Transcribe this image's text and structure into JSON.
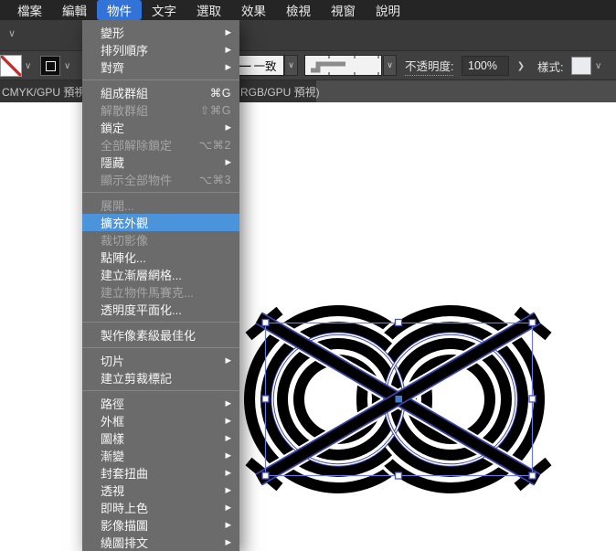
{
  "menubar": {
    "items": [
      {
        "label": "檔案",
        "active": false
      },
      {
        "label": "編輯",
        "active": false
      },
      {
        "label": "物件",
        "active": true
      },
      {
        "label": "文字",
        "active": false
      },
      {
        "label": "選取",
        "active": false
      },
      {
        "label": "效果",
        "active": false
      },
      {
        "label": "檢視",
        "active": false
      },
      {
        "label": "視窗",
        "active": false
      },
      {
        "label": "說明",
        "active": false
      }
    ],
    "highlight_color": "#3273d8"
  },
  "object_menu": {
    "highlight_color": "#4b94db",
    "items": [
      {
        "label": "變形",
        "arrow": true
      },
      {
        "label": "排列順序",
        "arrow": true
      },
      {
        "label": "對齊",
        "arrow": true,
        "sep": true
      },
      {
        "label": "組成群組",
        "shortcut": "⌘G"
      },
      {
        "label": "解散群組",
        "shortcut": "⇧⌘G",
        "disabled": true
      },
      {
        "label": "鎖定",
        "arrow": true
      },
      {
        "label": "全部解除鎖定",
        "shortcut": "⌥⌘2",
        "disabled": true
      },
      {
        "label": "隱藏",
        "arrow": true
      },
      {
        "label": "顯示全部物件",
        "shortcut": "⌥⌘3",
        "disabled": true,
        "sep": true
      },
      {
        "label": "展開...",
        "disabled": true
      },
      {
        "label": "擴充外觀",
        "highlighted": true
      },
      {
        "label": "裁切影像",
        "disabled": true
      },
      {
        "label": "點陣化..."
      },
      {
        "label": "建立漸層網格..."
      },
      {
        "label": "建立物件馬賽克...",
        "disabled": true
      },
      {
        "label": "透明度平面化...",
        "sep": true
      },
      {
        "label": "製作像素級最佳化",
        "sep": true
      },
      {
        "label": "切片",
        "arrow": true
      },
      {
        "label": "建立剪裁標記",
        "sep": true
      },
      {
        "label": "路徑",
        "arrow": true
      },
      {
        "label": "外框",
        "arrow": true
      },
      {
        "label": "圖樣",
        "arrow": true
      },
      {
        "label": "漸變",
        "arrow": true
      },
      {
        "label": "封套扭曲",
        "arrow": true
      },
      {
        "label": "透視",
        "arrow": true
      },
      {
        "label": "即時上色",
        "arrow": true
      },
      {
        "label": "影像描圖",
        "arrow": true
      },
      {
        "label": "繞圖排文",
        "arrow": true
      }
    ]
  },
  "toolbar": {
    "profile_dash": "—",
    "profile_value": "一致",
    "opacity_label": "不透明度:",
    "opacity_value": "100%",
    "opacity_stepper": "❯",
    "style_label": "樣式:",
    "chevron": "∨"
  },
  "tabbar": {
    "left_tab": "CMYK/GPU 預視)",
    "right_tab": "RGB/GPU 預視)"
  },
  "canvas": {
    "selection_color": "#4553c0",
    "handle_fill": "#ffffff",
    "center_handle_fill": "#3f7ed4",
    "artwork_color": "#000000"
  }
}
